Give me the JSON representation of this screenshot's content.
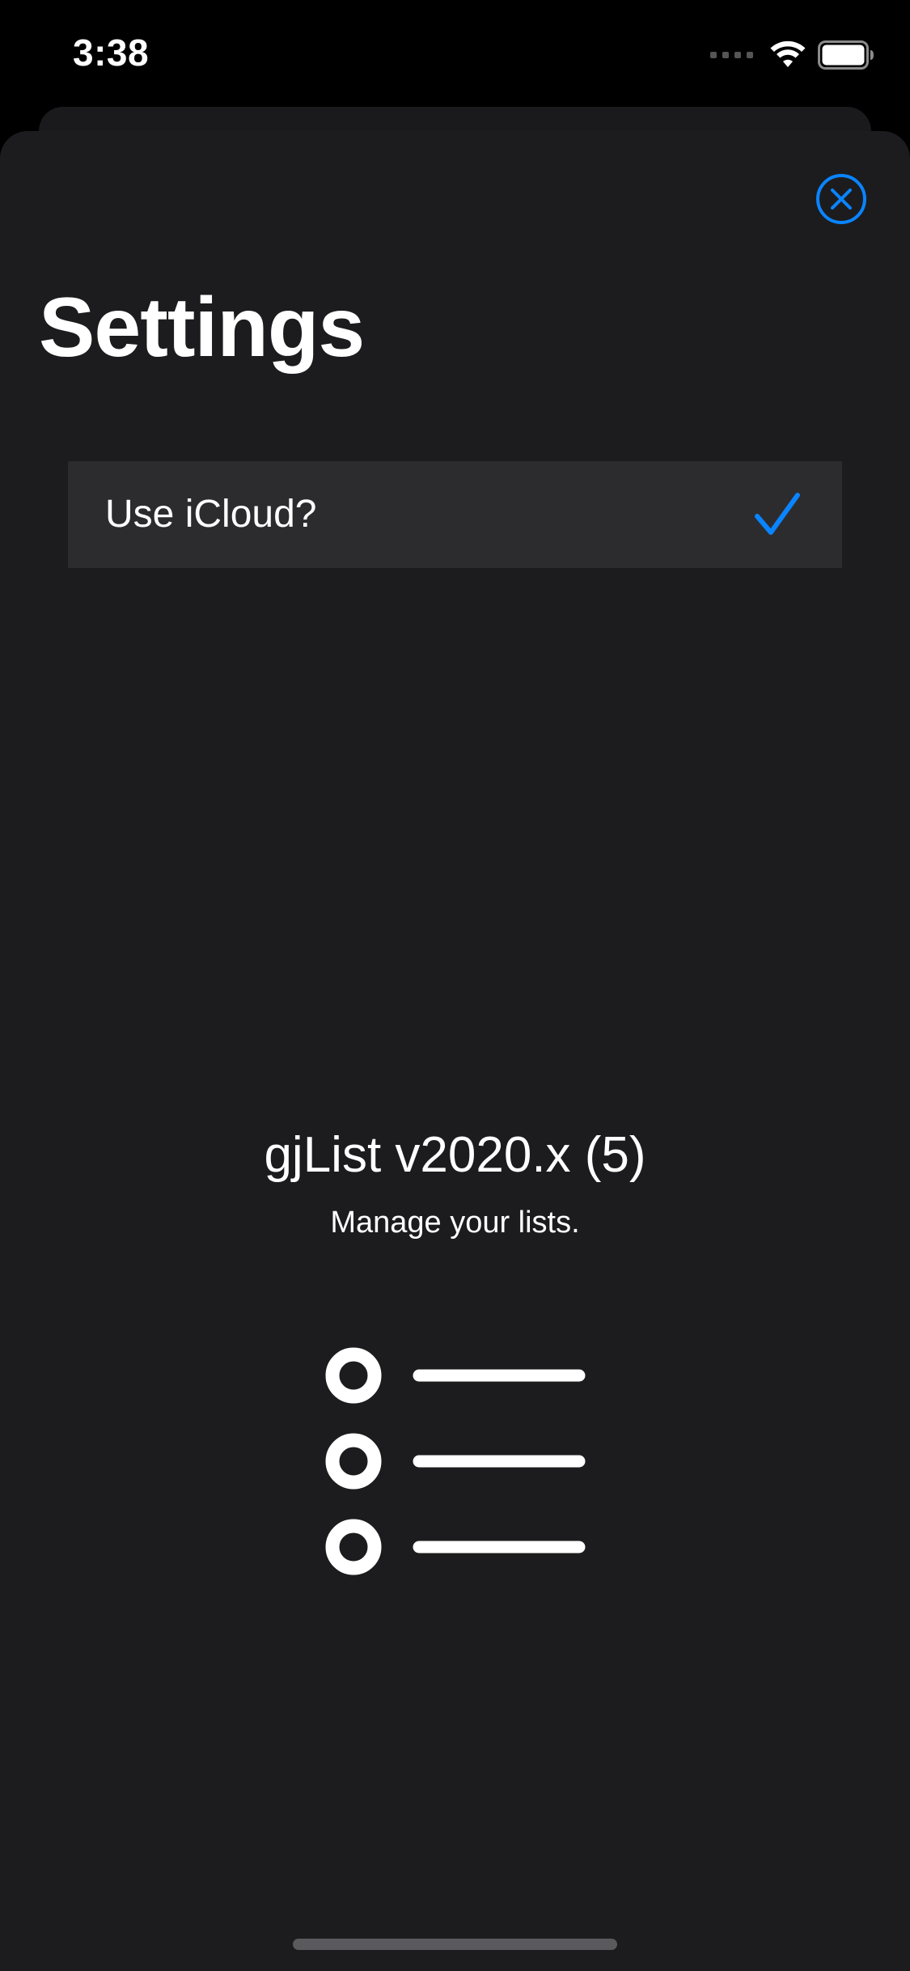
{
  "status_bar": {
    "time": "3:38"
  },
  "header": {
    "title": "Settings",
    "close_icon": "close-circle-icon"
  },
  "settings": {
    "rows": [
      {
        "label": "Use iCloud?",
        "checked": true
      }
    ]
  },
  "about": {
    "version": "gjList v2020.x (5)",
    "tagline": "Manage your lists."
  },
  "colors": {
    "accent": "#0a84ff",
    "background": "#1c1c1e",
    "row_background": "#2c2c2e",
    "text": "#ffffff"
  }
}
